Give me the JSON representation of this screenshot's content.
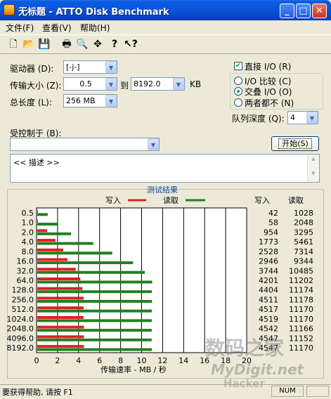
{
  "window": {
    "title": "无标题 - ATTO Disk Benchmark"
  },
  "menu": [
    {
      "label": "文件(F)"
    },
    {
      "label": "查看(V)"
    },
    {
      "label": "帮助(H)"
    }
  ],
  "toolbar": [
    "new-icon",
    "open-icon",
    "save-icon",
    "print-icon",
    "print-preview-icon",
    "move-icon",
    "help-icon",
    "context-help-icon"
  ],
  "form": {
    "drive_label": "驱动器 (D):",
    "drive_value": "[-j-]",
    "transfer_label": "传输大小 (Z):",
    "transfer_from": "0.5",
    "to_label": "到",
    "transfer_to": "8192.0",
    "unit": "KB",
    "length_label": "总长度 (L):",
    "length_value": "256 MB",
    "direct_io_label": "直接 I/O (R)",
    "io_compare_label": "I/O 比较 (C)",
    "overlap_label": "交叠 I/O (O)",
    "neither_label": "两者都不 (N)",
    "queue_label": "队列深度 (Q):",
    "queue_value": "4",
    "controlled_label": "受控制于 (B):",
    "controlled_value": "",
    "start_button": "开始(S)",
    "description": "<< 描述 >>"
  },
  "chart_data": {
    "type": "bar",
    "title": "测试结果",
    "legend": [
      {
        "name": "写入",
        "color": "#E02020"
      },
      {
        "name": "读取",
        "color": "#208020"
      }
    ],
    "xlabel": "传输速率 - MB / 秒",
    "xlim": [
      0,
      20
    ],
    "xticks": [
      "0",
      "2",
      "4",
      "6",
      "8",
      "10",
      "12",
      "14",
      "16",
      "18",
      "20"
    ],
    "categories": [
      "0.5",
      "1.0",
      "2.0",
      "4.0",
      "8.0",
      "16.0",
      "32.0",
      "64.0",
      "128.0",
      "256.0",
      "512.0",
      "1024.0",
      "2048.0",
      "4096.0",
      "8192.0"
    ],
    "series": [
      {
        "name": "写入",
        "color": "#E02020",
        "values": [
          0.04,
          0.06,
          0.93,
          1.73,
          2.47,
          2.88,
          3.66,
          4.1,
          4.3,
          4.41,
          4.41,
          4.41,
          4.44,
          4.44,
          4.44
        ]
      },
      {
        "name": "读取",
        "color": "#208020",
        "values": [
          1.0,
          2.0,
          3.22,
          5.33,
          7.14,
          9.12,
          10.24,
          10.94,
          10.91,
          10.92,
          10.91,
          10.91,
          10.9,
          10.89,
          10.91
        ]
      }
    ],
    "table_headers": {
      "write": "写入",
      "read": "读取"
    },
    "write_values": [
      "42",
      "58",
      "954",
      "1773",
      "2528",
      "2946",
      "3744",
      "4201",
      "4404",
      "4511",
      "4517",
      "4519",
      "4542",
      "4547",
      "4547"
    ],
    "read_values": [
      "1028",
      "2048",
      "3295",
      "5461",
      "7314",
      "9344",
      "10485",
      "11202",
      "11174",
      "11178",
      "11170",
      "11170",
      "11166",
      "11152",
      "11170"
    ]
  },
  "status": {
    "text": "要获得帮助, 请按 F1",
    "num": "NUM"
  },
  "watermark": {
    "line1": "数码之家",
    "line2": "MyDigit.net",
    "line3": "Hacker"
  },
  "colors": {
    "titlebar": "#0B53D8",
    "write": "#E02020",
    "read": "#208020",
    "chart_title": "#1040A0"
  }
}
